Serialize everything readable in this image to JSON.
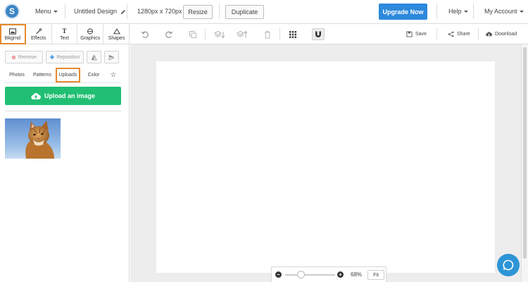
{
  "app": {
    "logo_letter": "S"
  },
  "topbar": {
    "menu_label": "Menu",
    "design_title": "Untitled Design",
    "dimensions": "1280px x 720px",
    "resize_label": "Resize",
    "duplicate_label": "Duplicate",
    "upgrade_label": "Upgrade Now",
    "help_label": "Help",
    "account_label": "My Account"
  },
  "categories": [
    {
      "label": "Bkgrnd",
      "icon": "background-image-icon",
      "active": true
    },
    {
      "label": "Effects",
      "icon": "wand-icon"
    },
    {
      "label": "Text",
      "icon": "text-t-icon",
      "glyph": "T"
    },
    {
      "label": "Graphics",
      "icon": "graphics-icon"
    },
    {
      "label": "Shapes",
      "icon": "triangle-icon"
    }
  ],
  "actions": {
    "remove_label": "Remove",
    "reposition_label": "Reposition"
  },
  "subtabs": [
    {
      "label": "Photos"
    },
    {
      "label": "Patterns"
    },
    {
      "label": "Uploads",
      "active": true
    },
    {
      "label": "Color"
    },
    {
      "label": "",
      "icon": "star-icon"
    }
  ],
  "uploads": {
    "upload_button_label": "Upload an image",
    "items": [
      {
        "kind": "image",
        "subject": "cat-photo"
      }
    ]
  },
  "toolbar": {
    "save_label": "Save",
    "share_label": "Share",
    "download_label": "Download"
  },
  "zoom": {
    "percent_label": "68%",
    "fit_label": "Fit",
    "level": 0.68
  },
  "colors": {
    "accent_blue": "#2d89dc",
    "upload_green": "#21bf73",
    "highlight_orange": "#e48a2e",
    "workspace_gray": "#ededed"
  }
}
